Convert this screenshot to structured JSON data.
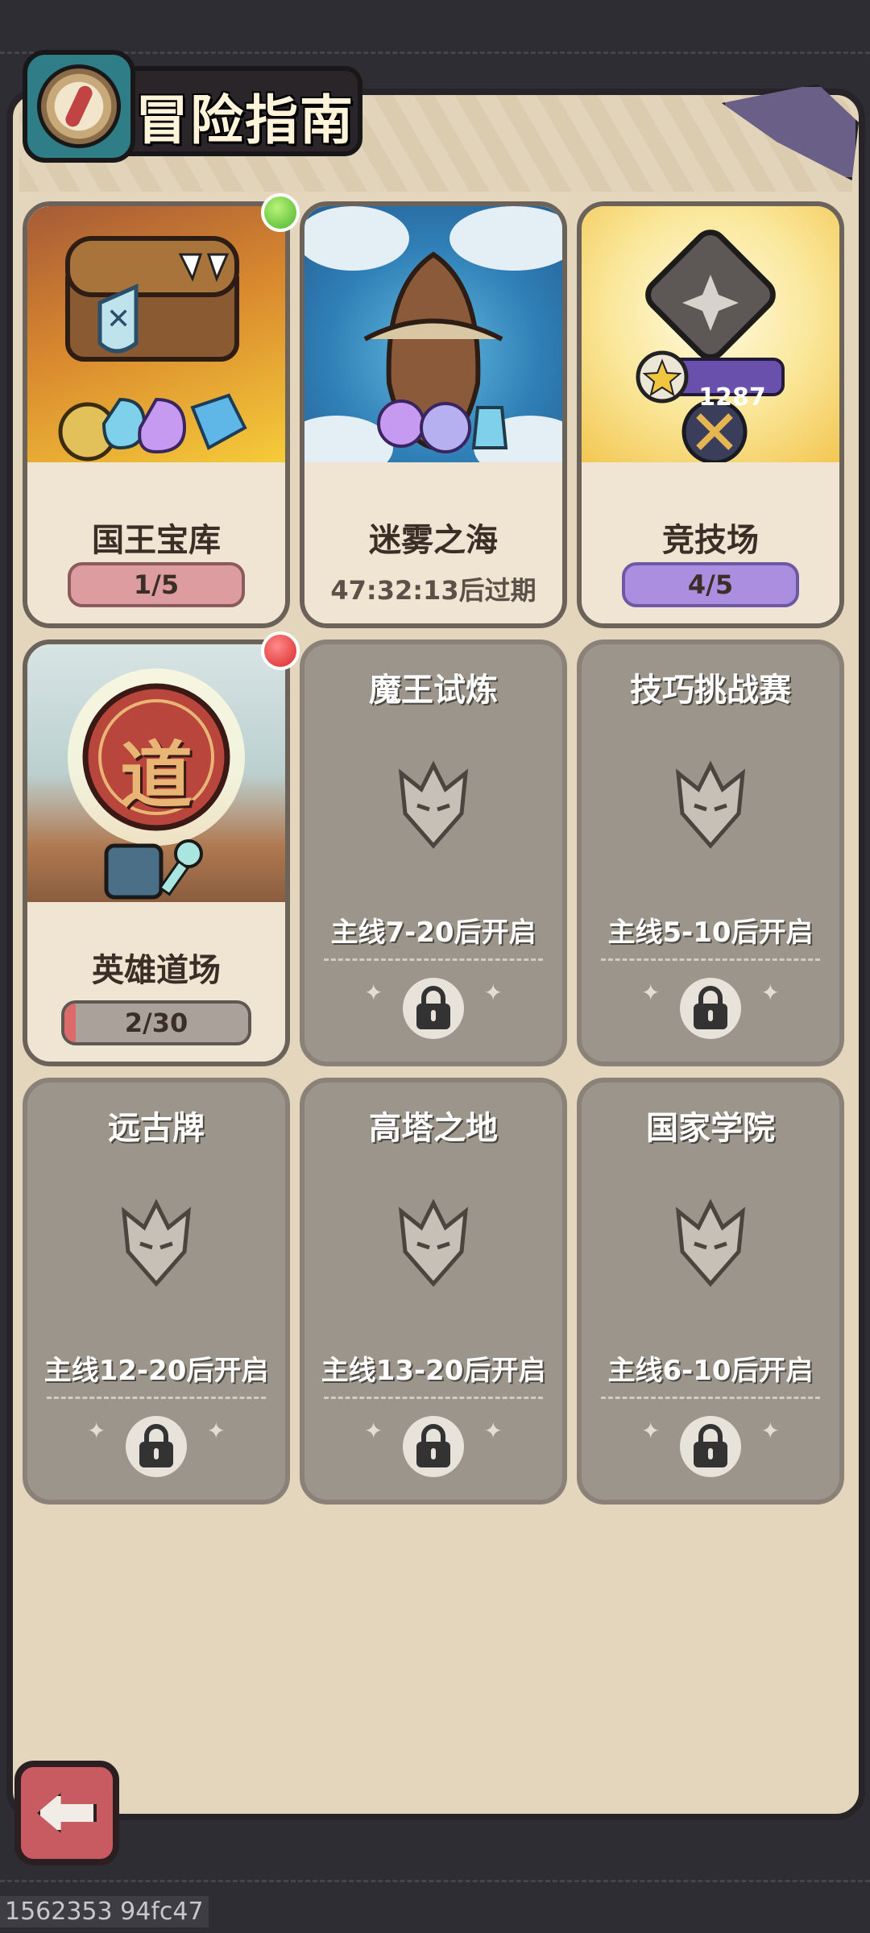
{
  "header": {
    "title": "冒险指南"
  },
  "cards": [
    {
      "name": "国王宝库",
      "progress": "1/5",
      "dot": "green"
    },
    {
      "name": "迷雾之海",
      "expire": "47:32:13后过期"
    },
    {
      "name": "竞技场",
      "progress": "4/5",
      "score": "1287"
    },
    {
      "name": "英雄道场",
      "progress": "2/30",
      "dot": "red",
      "seal": "道"
    },
    {
      "name": "魔王试炼",
      "unlock": "主线7-20后开启"
    },
    {
      "name": "技巧挑战赛",
      "unlock": "主线5-10后开启"
    },
    {
      "name": "远古牌",
      "unlock": "主线12-20后开启"
    },
    {
      "name": "高塔之地",
      "unlock": "主线13-20后开启"
    },
    {
      "name": "国家学院",
      "unlock": "主线6-10后开启"
    }
  ],
  "footer": {
    "debug_id": "1562353 94fc47"
  },
  "colors": {
    "panel": "#e3d6bd",
    "locked_card": "#9c958b",
    "progress_red": "#dd9ca0",
    "progress_purple": "#ab8ee0",
    "back_button": "#c85b62"
  }
}
